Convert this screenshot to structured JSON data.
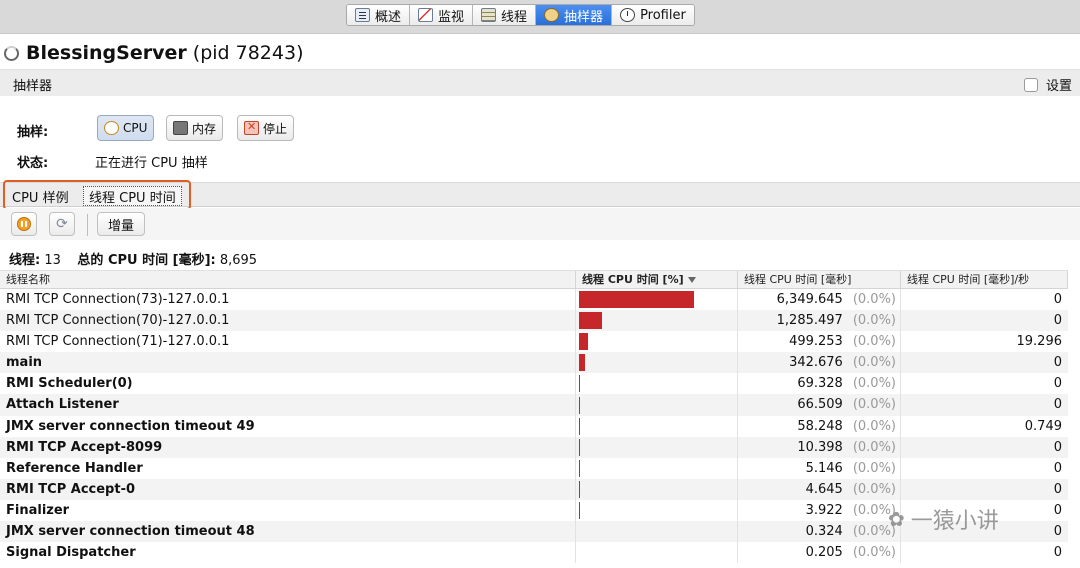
{
  "top_tabs": [
    {
      "label": "概述",
      "icon": "overview-icon",
      "active": false
    },
    {
      "label": "监视",
      "icon": "monitor-icon",
      "active": false
    },
    {
      "label": "线程",
      "icon": "threads-icon",
      "active": false
    },
    {
      "label": "抽样器",
      "icon": "sampler-icon",
      "active": true
    },
    {
      "label": "Profiler",
      "icon": "profiler-icon",
      "active": false
    }
  ],
  "title": {
    "app": "BlessingServer",
    "pid": "(pid 78243)"
  },
  "section": {
    "title": "抽样器",
    "settings_label": "设置"
  },
  "sampling": {
    "label": "抽样:",
    "cpu_button": "CPU",
    "memory_button": "内存",
    "stop_button": "停止",
    "status_label": "状态:",
    "status_value": "正在进行 CPU 抽样"
  },
  "inner_tabs": [
    {
      "label": "CPU 样例",
      "selected": false
    },
    {
      "label": "线程 CPU 时间",
      "selected": true
    }
  ],
  "toolbar": {
    "delta_button": "增量"
  },
  "summary": {
    "threads_label": "线程:",
    "threads_value": "13",
    "total_label": "总的 CPU 时间 [毫秒]:",
    "total_value": "8,695"
  },
  "table": {
    "headers": [
      "线程名称",
      "线程 CPU 时间 [%]",
      "线程 CPU 时间 [毫秒]",
      "线程 CPU 时间 [毫秒]/秒"
    ],
    "bar_color": "#c6272b",
    "rows": [
      {
        "name": "RMI TCP Connection(73)-127.0.0.1",
        "share_pct": 73.0,
        "ms": "6,349.645",
        "pct": "(0.0%)",
        "rate": "0",
        "bold": false
      },
      {
        "name": "RMI TCP Connection(70)-127.0.0.1",
        "share_pct": 14.8,
        "ms": "1,285.497",
        "pct": "(0.0%)",
        "rate": "0",
        "bold": false
      },
      {
        "name": "RMI TCP Connection(71)-127.0.0.1",
        "share_pct": 5.7,
        "ms": "499.253",
        "pct": "(0.0%)",
        "rate": "19.296",
        "bold": false
      },
      {
        "name": "main",
        "share_pct": 3.9,
        "ms": "342.676",
        "pct": "(0.0%)",
        "rate": "0",
        "bold": true
      },
      {
        "name": "RMI Scheduler(0)",
        "share_pct": 0.8,
        "ms": "69.328",
        "pct": "(0.0%)",
        "rate": "0",
        "bold": true
      },
      {
        "name": "Attach Listener",
        "share_pct": 0.8,
        "ms": "66.509",
        "pct": "(0.0%)",
        "rate": "0",
        "bold": true
      },
      {
        "name": "JMX server connection timeout 49",
        "share_pct": 0.7,
        "ms": "58.248",
        "pct": "(0.0%)",
        "rate": "0.749",
        "bold": true
      },
      {
        "name": "RMI TCP Accept-8099",
        "share_pct": 0.1,
        "ms": "10.398",
        "pct": "(0.0%)",
        "rate": "0",
        "bold": true
      },
      {
        "name": "Reference Handler",
        "share_pct": 0.06,
        "ms": "5.146",
        "pct": "(0.0%)",
        "rate": "0",
        "bold": true
      },
      {
        "name": "RMI TCP Accept-0",
        "share_pct": 0.05,
        "ms": "4.645",
        "pct": "(0.0%)",
        "rate": "0",
        "bold": true
      },
      {
        "name": "Finalizer",
        "share_pct": 0.05,
        "ms": "3.922",
        "pct": "(0.0%)",
        "rate": "0",
        "bold": true
      },
      {
        "name": "JMX server connection timeout 48",
        "share_pct": 0.0,
        "ms": "0.324",
        "pct": "(0.0%)",
        "rate": "0",
        "bold": true
      },
      {
        "name": "Signal Dispatcher",
        "share_pct": 0.0,
        "ms": "0.205",
        "pct": "(0.0%)",
        "rate": "0",
        "bold": true
      }
    ]
  },
  "watermark": {
    "text": "一猿小讲"
  }
}
